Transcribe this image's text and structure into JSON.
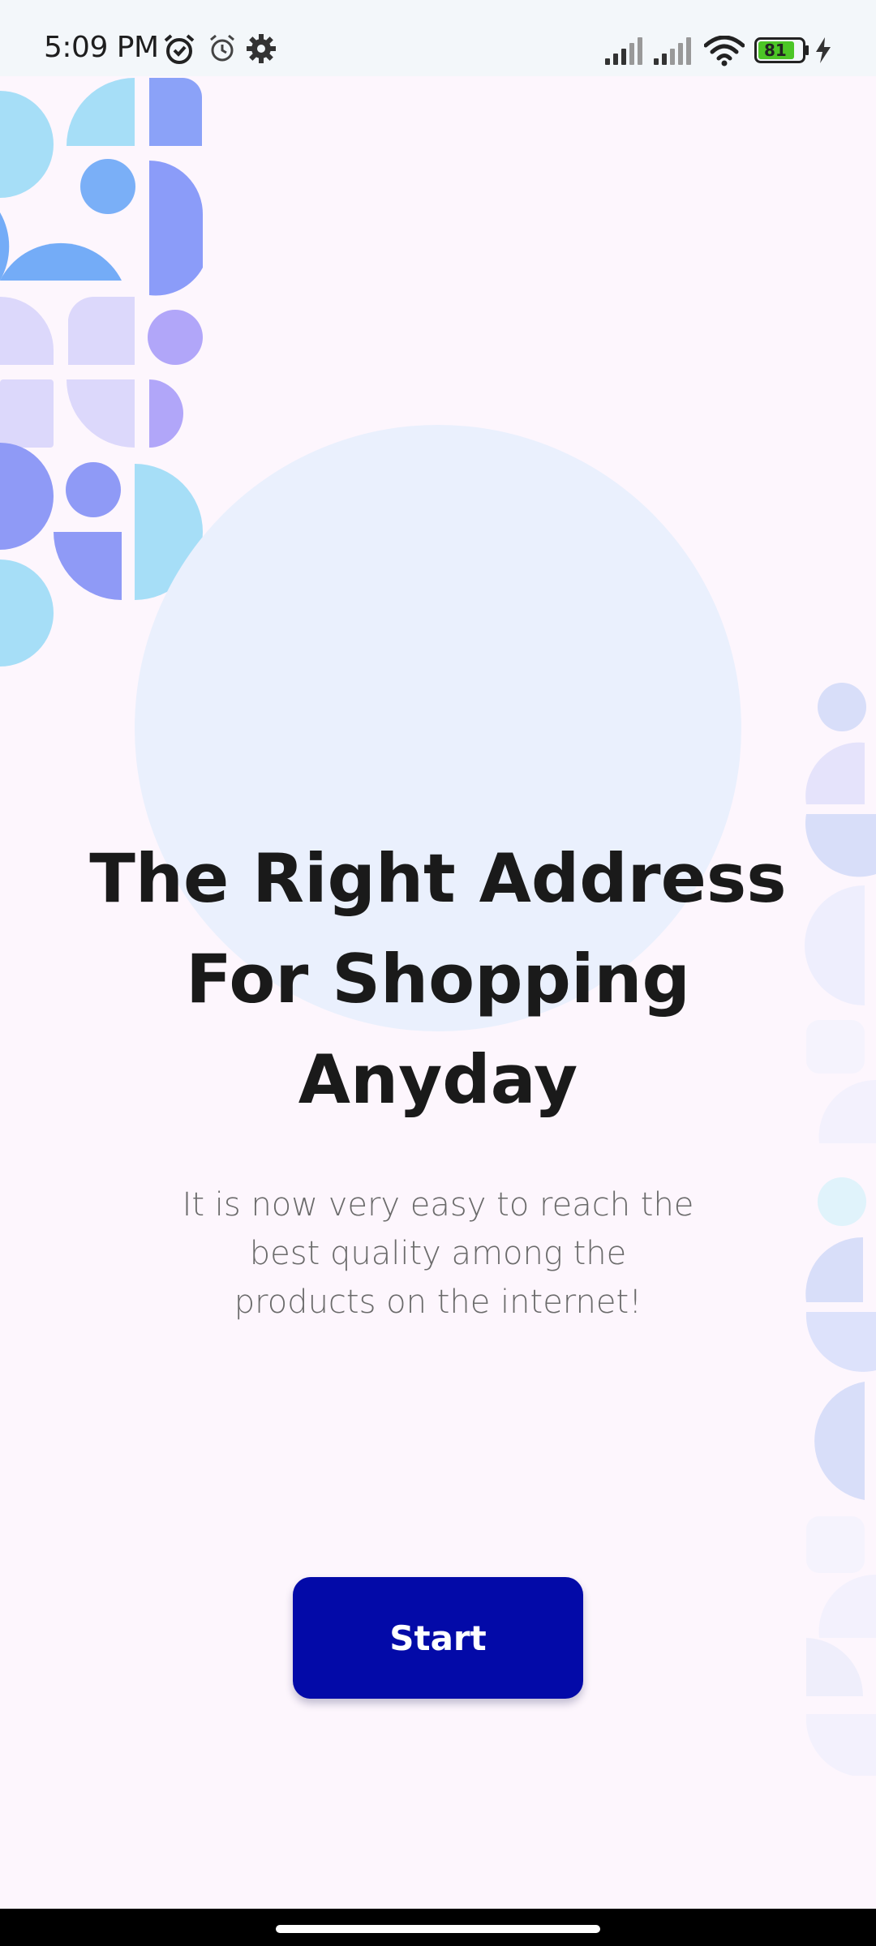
{
  "status_bar": {
    "time": "5:09 PM",
    "battery_level": "81",
    "icons": [
      "alarm-active-icon",
      "alarm-icon",
      "settings-icon",
      "signal-icon",
      "signal-icon",
      "wifi-icon",
      "battery-icon",
      "charging-icon"
    ]
  },
  "onboarding": {
    "headline_line1": "The Right Address",
    "headline_line2": "For Shopping",
    "headline_line3": "Anyday",
    "subtitle_line1": "It is now very easy to reach the",
    "subtitle_line2": "best quality among the",
    "subtitle_line3": "products on the internet!",
    "start_label": "Start"
  },
  "colors": {
    "background": "#fdf6fd",
    "primary_button": "#030aa8",
    "hero_circle": "#eaf0fd",
    "headline": "#1a1a1a",
    "subtitle": "#6b6b6b"
  }
}
